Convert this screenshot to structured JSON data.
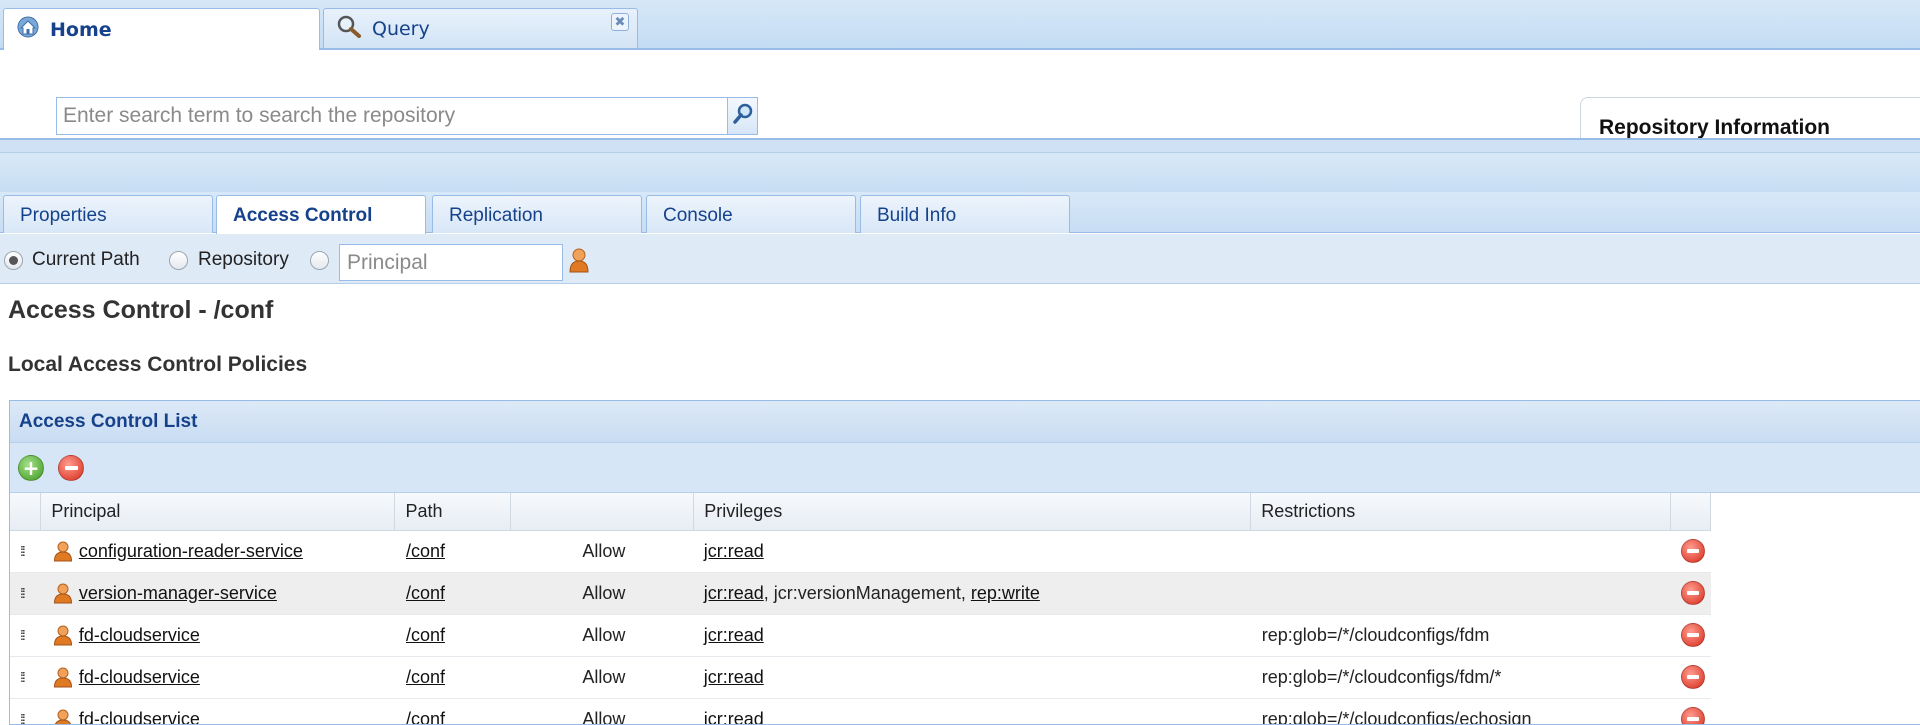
{
  "top_tabs": [
    {
      "label": "Home",
      "icon": "home-icon",
      "active": true
    },
    {
      "label": "Query",
      "icon": "magnifier-icon",
      "active": false,
      "close": "✖"
    }
  ],
  "search": {
    "placeholder": "Enter search term to search the repository",
    "button_icon": "search-icon"
  },
  "repo_info": {
    "title": "Repository Information"
  },
  "panel_tabs": [
    {
      "label": "Properties",
      "active": false
    },
    {
      "label": "Access Control",
      "active": true
    },
    {
      "label": "Replication",
      "active": false
    },
    {
      "label": "Console",
      "active": false
    },
    {
      "label": "Build Info",
      "active": false
    }
  ],
  "scope": {
    "options": [
      "Current Path",
      "Repository"
    ],
    "selected": "Current Path",
    "principal_placeholder": "Principal"
  },
  "page_title": "Access Control - /conf",
  "section_title": "Local Access Control Policies",
  "acl": {
    "title": "Access Control List",
    "columns": [
      "Principal",
      "Path",
      "",
      "Privileges",
      "Restrictions",
      ""
    ],
    "rows": [
      {
        "principal": "configuration-reader-service",
        "path": "/conf",
        "effect": "Allow",
        "privileges": [
          {
            "text": "jcr:read",
            "link": true
          }
        ],
        "restrictions": ""
      },
      {
        "principal": "version-manager-service",
        "path": "/conf",
        "effect": "Allow",
        "privileges": [
          {
            "text": "jcr:read",
            "link": true
          },
          {
            "text": ", jcr:versionManagement, ",
            "link": false
          },
          {
            "text": "rep:write",
            "link": true
          }
        ],
        "restrictions": ""
      },
      {
        "principal": "fd-cloudservice",
        "path": "/conf",
        "effect": "Allow",
        "privileges": [
          {
            "text": "jcr:read",
            "link": true
          }
        ],
        "restrictions": "rep:glob=/*/cloudconfigs/fdm"
      },
      {
        "principal": "fd-cloudservice",
        "path": "/conf",
        "effect": "Allow",
        "privileges": [
          {
            "text": "jcr:read",
            "link": true
          }
        ],
        "restrictions": "rep:glob=/*/cloudconfigs/fdm/*"
      },
      {
        "principal": "fd-cloudservice",
        "path": "/conf",
        "effect": "Allow",
        "privileges": [
          {
            "text": "jcr:read",
            "link": true
          }
        ],
        "restrictions": "rep:glob=/*/cloudconfigs/echosign"
      }
    ]
  },
  "colors": {
    "accent": "#15428b",
    "allow": "#3a8a1c",
    "border": "#99bbe8",
    "delete": "#d62a1a",
    "add": "#3c9a1e"
  }
}
